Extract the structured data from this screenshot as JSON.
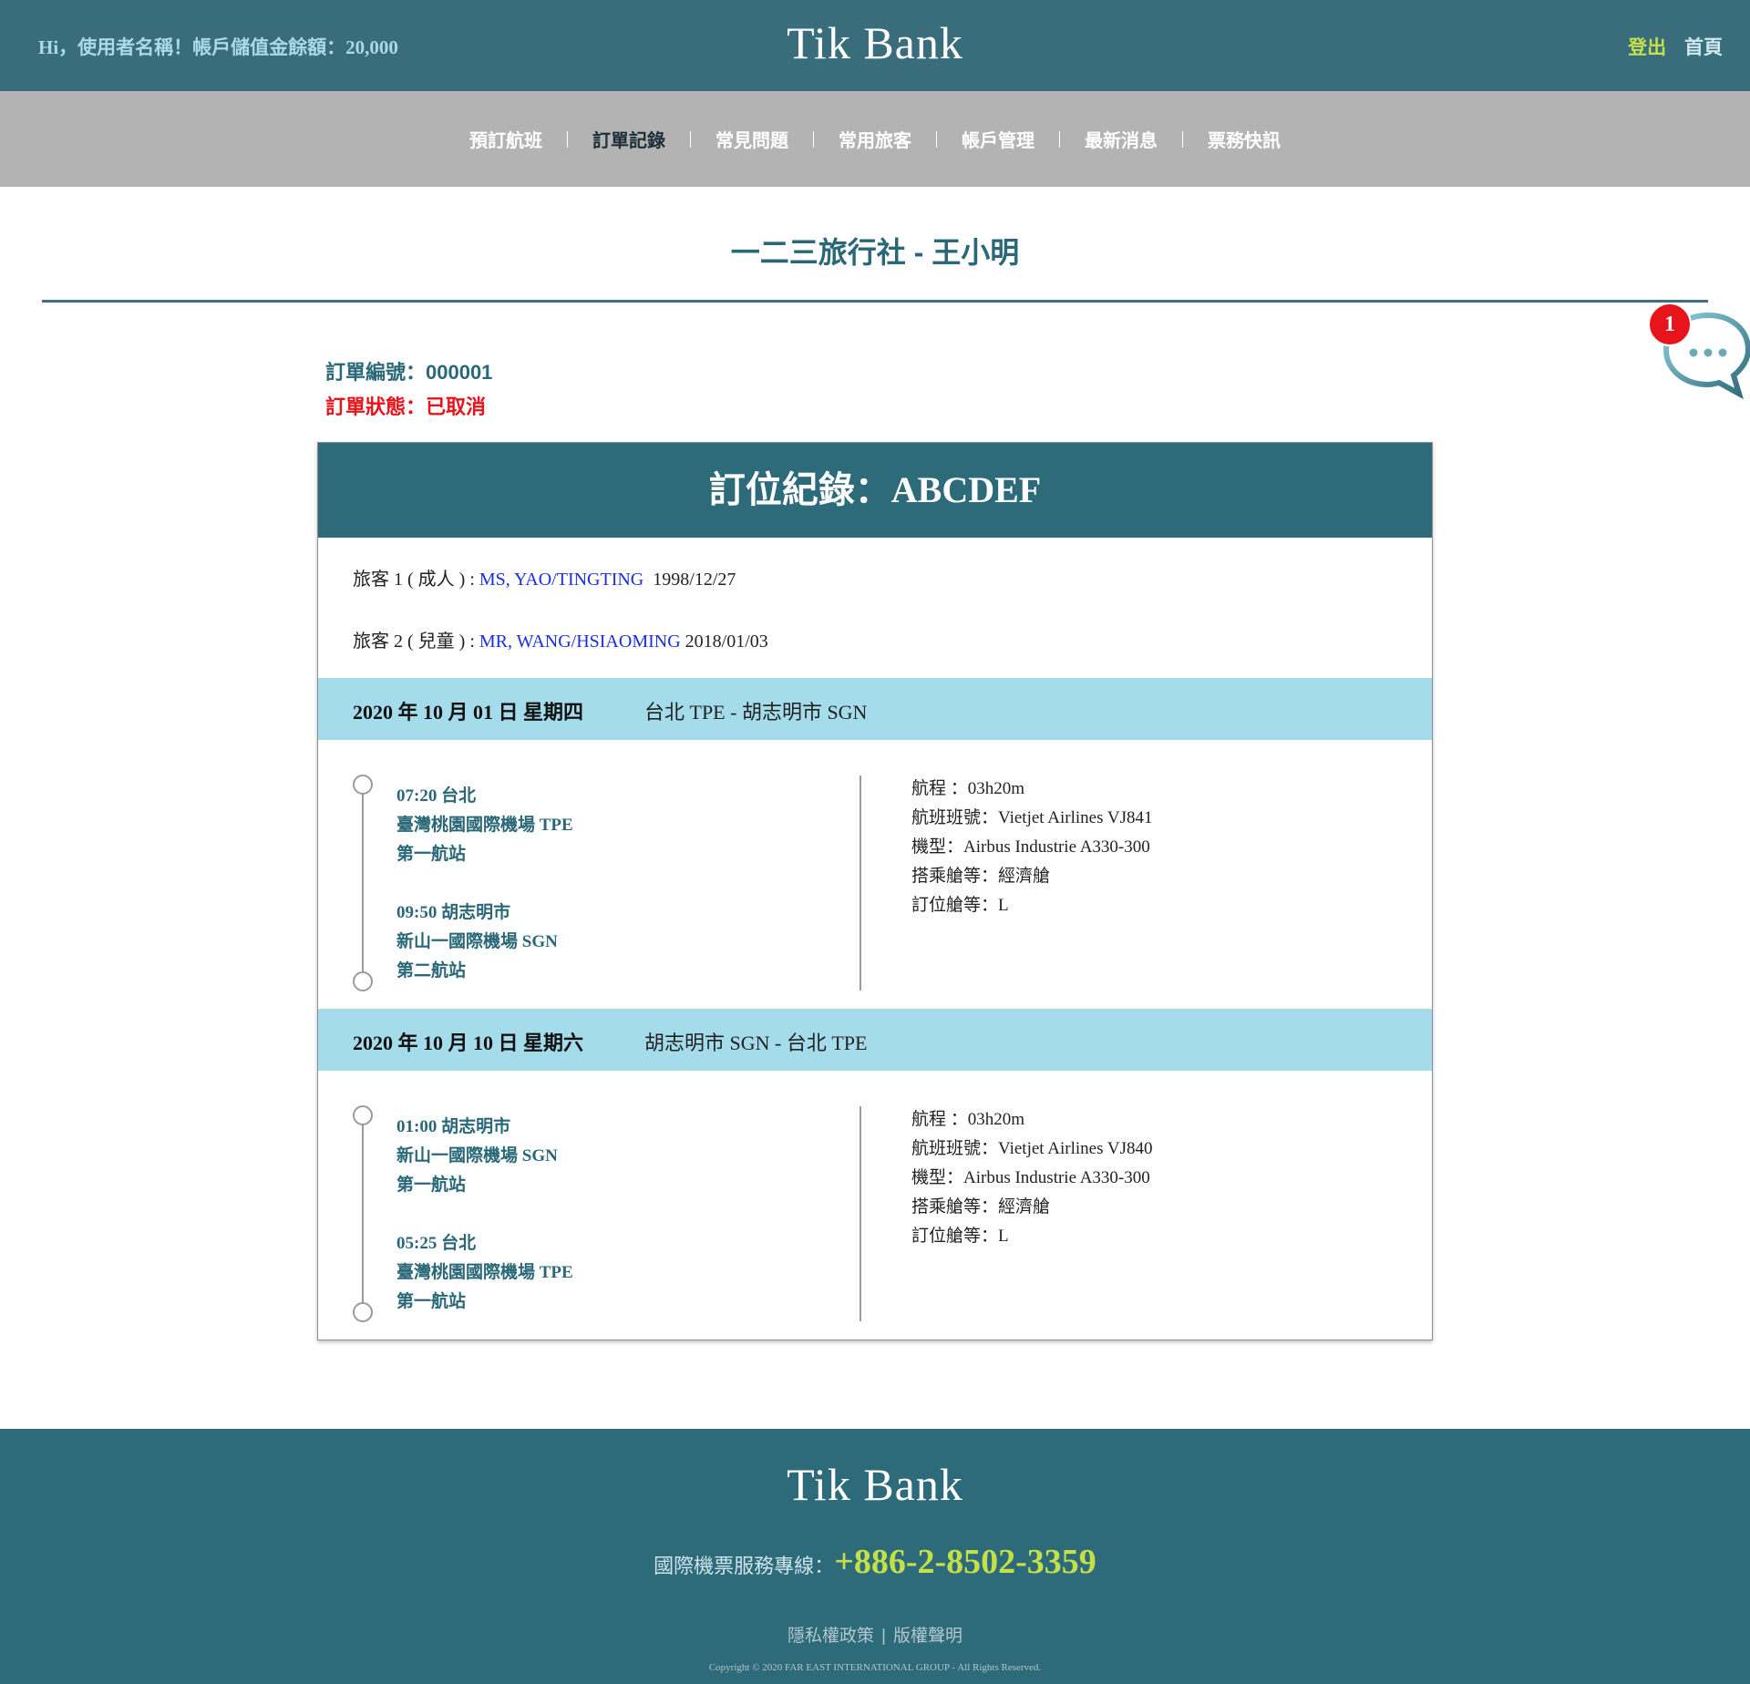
{
  "header": {
    "greeting": "Hi，使用者名稱！帳戶儲值金餘額：20,000",
    "logo": "Tik Bank",
    "logout": "登出",
    "home": "首頁"
  },
  "nav": {
    "items": [
      {
        "label": "預訂航班",
        "active": false
      },
      {
        "label": "訂單記錄",
        "active": true
      },
      {
        "label": "常見問題",
        "active": false
      },
      {
        "label": "常用旅客",
        "active": false
      },
      {
        "label": "帳戶管理",
        "active": false
      },
      {
        "label": "最新消息",
        "active": false
      },
      {
        "label": "票務快訊",
        "active": false
      }
    ]
  },
  "page": {
    "title": "一二三旅行社 - 王小明"
  },
  "chat": {
    "badge": "1",
    "icon": "chat-bubble-icon"
  },
  "order": {
    "number": "訂單編號：000001",
    "status": "訂單狀態：已取消"
  },
  "booking": {
    "title": "訂位紀錄：ABCDEF",
    "passengers": [
      {
        "label": "旅客 1 ( 成人 ) : ",
        "name": "MS, YAO/TINGTING",
        "dob": "  1998/12/27"
      },
      {
        "label": "旅客 2 ( 兒童 ) : ",
        "name": "MR, WANG/HSIAOMING",
        "dob": " 2018/01/03"
      }
    ],
    "segments": [
      {
        "date": "2020 年 10 月 01 日 星期四",
        "route": "台北 TPE - 胡志明市 SGN",
        "departure": {
          "time_city": "07:20 台北",
          "airport": "臺灣桃園國際機場 TPE",
          "terminal": "第一航站"
        },
        "arrival": {
          "time_city": "09:50 胡志明市",
          "airport": "新山一國際機場 SGN",
          "terminal": "第二航站"
        },
        "details": {
          "duration": "航程 ：03h20m",
          "flight": "航班班號：Vietjet Airlines VJ841",
          "aircraft": "機型：Airbus Industrie A330-300",
          "cabin": "搭乘艙等：經濟艙",
          "booking_class": "訂位艙等：L"
        }
      },
      {
        "date": "2020 年 10 月 10 日 星期六",
        "route": "胡志明市 SGN - 台北 TPE",
        "departure": {
          "time_city": "01:00 胡志明市",
          "airport": "新山一國際機場 SGN",
          "terminal": "第一航站"
        },
        "arrival": {
          "time_city": "05:25 台北",
          "airport": "臺灣桃園國際機場 TPE",
          "terminal": "第一航站"
        },
        "details": {
          "duration": "航程 ：03h20m",
          "flight": "航班班號：Vietjet Airlines VJ840",
          "aircraft": "機型：Airbus Industrie A330-300",
          "cabin": "搭乘艙等：經濟艙",
          "booking_class": "訂位艙等：L"
        }
      }
    ]
  },
  "footer": {
    "logo": "Tik Bank",
    "hotline_label": "國際機票服務專線：",
    "hotline_number": "+886-2-8502-3359",
    "privacy": "隱私權政策",
    "separator": "|",
    "copyright_link": "版權聲明",
    "copyright": "Copyright © 2020 FAR EAST INTERNATIONAL GROUP - All Rights Reserved."
  },
  "colors": {
    "header_bg": "#3a6d7c",
    "nav_bg": "#b3b3b3",
    "accent": "#2d6a7a",
    "segment_bg": "#a4dceb",
    "status_red": "#e8141b",
    "lime": "#c3e04a",
    "name_blue": "#1a2ee0"
  }
}
